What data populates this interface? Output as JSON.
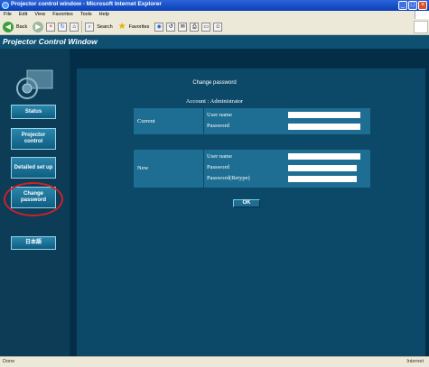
{
  "browser": {
    "title": "Projector control window - Microsoft Internet Explorer",
    "menu": [
      "File",
      "Edit",
      "View",
      "Favorites",
      "Tools",
      "Help"
    ],
    "toolbar": {
      "back_label": "Back",
      "search_label": "Search",
      "favorites_label": "Favorites"
    },
    "status_left": "Done",
    "status_right": "Internet"
  },
  "app": {
    "title": "Projector Control Window"
  },
  "sidebar": {
    "items": [
      {
        "label": "Status"
      },
      {
        "label": "Projector control"
      },
      {
        "label": "Detailed set up"
      },
      {
        "label": "Change password"
      },
      {
        "label": "日本語"
      }
    ]
  },
  "page": {
    "title": "Change password",
    "account_line": "Account : Administrator",
    "current": {
      "label": "Current",
      "fields": [
        {
          "label": "User name",
          "value": ""
        },
        {
          "label": "Password",
          "value": ""
        }
      ]
    },
    "new": {
      "label": "New",
      "fields": [
        {
          "label": "User name",
          "value": ""
        },
        {
          "label": "Password",
          "value": ""
        },
        {
          "label": "Password(Retype)",
          "value": ""
        }
      ]
    },
    "ok_label": "OK"
  },
  "colors": {
    "header_bg": "#0f4f72",
    "sidebar_bg": "#0d3c56",
    "panel_bg": "#0c4968",
    "section_bg": "#1d6e92",
    "highlight": "#d0202a"
  }
}
